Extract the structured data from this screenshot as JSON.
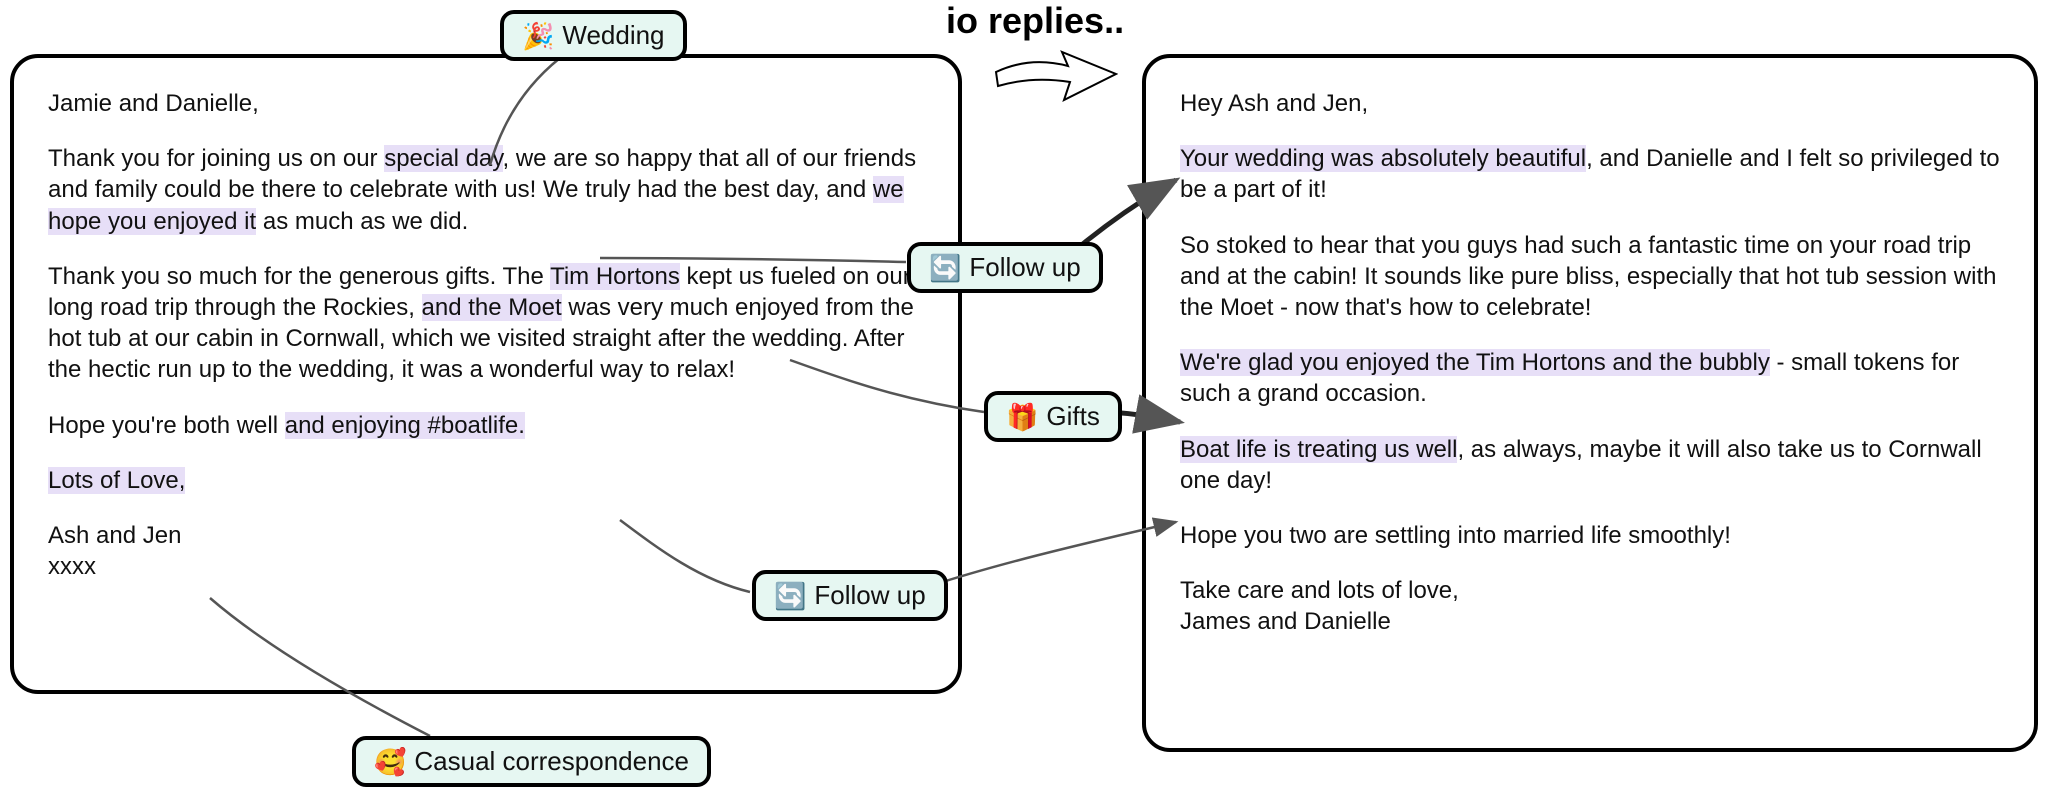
{
  "hero": {
    "partial_text": "io replies.."
  },
  "tags": {
    "wedding": {
      "emoji": "🎉",
      "label": "Wedding"
    },
    "followup1": {
      "emoji": "🔄",
      "label": "Follow up"
    },
    "gifts": {
      "emoji": "🎁",
      "label": "Gifts"
    },
    "followup2": {
      "emoji": "🔄",
      "label": "Follow up"
    },
    "casual": {
      "emoji": "🥰",
      "label": "Casual correspondence"
    }
  },
  "left": {
    "greeting": "Jamie and Danielle,",
    "p1a": "Thank you for joining us on our ",
    "p1hl1": "special day",
    "p1b": ", we are so happy that all of our friends and family could be there to celebrate with us! We truly had the best day, and ",
    "p1hl2": "we hope you enjoyed it",
    "p1c": " as much as we did.",
    "p2a": "Thank you so much for the generous gifts. The ",
    "p2hl1": "Tim Hortons",
    "p2b": " kept us fueled on our long road trip through the Rockies, ",
    "p2hl2": "and the Moet",
    "p2c": " was very much enjoyed from the hot tub at our cabin in Cornwall, which we visited straight after the wedding. After the hectic run up to the wedding, it was a wonderful way to relax!",
    "p3a": "Hope you're both well ",
    "p3hl1": "and enjoying #boatlife.",
    "p4hl": "Lots of Love,",
    "sig1": "Ash and Jen",
    "sig2": "xxxx"
  },
  "right": {
    "greeting": "Hey Ash and Jen,",
    "p1hl": "Your wedding was absolutely beautiful",
    "p1b": ", and Danielle and I felt so privileged to be a part of it!",
    "p2": "So stoked to hear that you guys had such a fantastic time on your road trip and at the cabin! It sounds like pure bliss, especially that hot tub session with the Moet - now that's how to celebrate!",
    "p3a": " ",
    "p3hl": "We're glad you enjoyed the Tim Hortons and the bubbly",
    "p3b": " - small tokens for such a grand occasion.",
    "p4hl": "Boat life is treating us well",
    "p4b": ", as always, maybe it will also take us to Cornwall one day!",
    "p5": "Hope you two are settling into married life smoothly!",
    "sig1": "Take care and lots of love,",
    "sig2": "James and Danielle"
  }
}
